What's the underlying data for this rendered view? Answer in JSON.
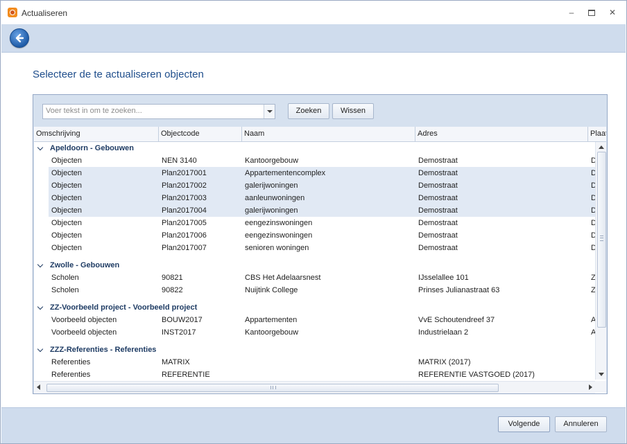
{
  "window": {
    "title": "Actualiseren",
    "controls": {
      "minimize": "–",
      "close": "✕"
    }
  },
  "toolbar": {
    "back_icon": "back-arrow-icon"
  },
  "heading": "Selecteer de te actualiseren objecten",
  "search": {
    "placeholder": "Voer tekst in om te zoeken...",
    "value": "",
    "search_label": "Zoeken",
    "clear_label": "Wissen"
  },
  "columns": [
    "Omschrijving",
    "Objectcode",
    "Naam",
    "Adres",
    "Plaat"
  ],
  "groups": [
    {
      "title": "Apeldoorn - Gebouwen",
      "rows": [
        {
          "omschrijving": "Objecten",
          "objectcode": "NEN 3140",
          "naam": "Kantoorgebouw",
          "adres": "Demostraat",
          "plaats": "D",
          "selected": false
        },
        {
          "omschrijving": "Objecten",
          "objectcode": "Plan2017001",
          "naam": "Appartementencomplex",
          "adres": "Demostraat",
          "plaats": "D",
          "selected": true
        },
        {
          "omschrijving": "Objecten",
          "objectcode": "Plan2017002",
          "naam": "galerijwoningen",
          "adres": "Demostraat",
          "plaats": "D",
          "selected": true
        },
        {
          "omschrijving": "Objecten",
          "objectcode": "Plan2017003",
          "naam": "aanleunwoningen",
          "adres": "Demostraat",
          "plaats": "D",
          "selected": true
        },
        {
          "omschrijving": "Objecten",
          "objectcode": "Plan2017004",
          "naam": "galerijwoningen",
          "adres": "Demostraat",
          "plaats": "D",
          "selected": true
        },
        {
          "omschrijving": "Objecten",
          "objectcode": "Plan2017005",
          "naam": "eengezinswoningen",
          "adres": "Demostraat",
          "plaats": "D",
          "selected": false
        },
        {
          "omschrijving": "Objecten",
          "objectcode": "Plan2017006",
          "naam": "eengezinswoningen",
          "adres": "Demostraat",
          "plaats": "D",
          "selected": false
        },
        {
          "omschrijving": "Objecten",
          "objectcode": "Plan2017007",
          "naam": "senioren woningen",
          "adres": "Demostraat",
          "plaats": "D",
          "selected": false
        }
      ]
    },
    {
      "title": "Zwolle - Gebouwen",
      "rows": [
        {
          "omschrijving": "Scholen",
          "objectcode": "90821",
          "naam": "CBS Het Adelaarsnest",
          "adres": "IJsselallee 101",
          "plaats": "Z",
          "selected": false
        },
        {
          "omschrijving": "Scholen",
          "objectcode": "90822",
          "naam": "Nuijtink College",
          "adres": "Prinses Julianastraat 63",
          "plaats": "Z",
          "selected": false
        }
      ]
    },
    {
      "title": "ZZ-Voorbeeld project - Voorbeeld project",
      "rows": [
        {
          "omschrijving": "Voorbeeld objecten",
          "objectcode": "BOUW2017",
          "naam": "Appartementen",
          "adres": "VvE Schoutendreef 37",
          "plaats": "A",
          "selected": false
        },
        {
          "omschrijving": "Voorbeeld objecten",
          "objectcode": "INST2017",
          "naam": "Kantoorgebouw",
          "adres": "Industrielaan 2",
          "plaats": "A",
          "selected": false
        }
      ]
    },
    {
      "title": "ZZZ-Referenties - Referenties",
      "rows": [
        {
          "omschrijving": "Referenties",
          "objectcode": "MATRIX",
          "naam": "",
          "adres": "MATRIX (2017)",
          "plaats": "",
          "selected": false
        },
        {
          "omschrijving": "Referenties",
          "objectcode": "REFERENTIE",
          "naam": "",
          "adres": "REFERENTIE VASTGOED (2017)",
          "plaats": "",
          "selected": false
        }
      ]
    }
  ],
  "footer": {
    "next_label": "Volgende",
    "cancel_label": "Annuleren"
  },
  "colors": {
    "accent": "#1f4e8c",
    "selection": "#e1e9f4",
    "band": "#cfdced"
  }
}
